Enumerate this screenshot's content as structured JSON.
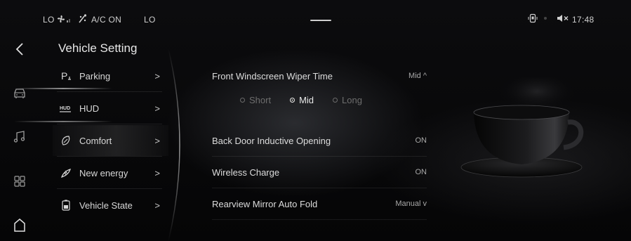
{
  "status_bar": {
    "left_temp": "LO",
    "ac_text": "A/C ON",
    "right_temp": "LO",
    "time": "17:48",
    "icons": [
      "fan-icon",
      "ac-icon",
      "phone-projection-icon",
      "mute-icon"
    ]
  },
  "nav": {
    "icons": [
      "back-icon",
      "car-icon",
      "music-icon",
      "apps-icon",
      "home-icon"
    ]
  },
  "page": {
    "title": "Vehicle Setting"
  },
  "menu": {
    "items": [
      {
        "label": "Parking",
        "arrow": ">",
        "icon": "parking-icon"
      },
      {
        "label": "HUD",
        "arrow": ">",
        "icon": "hud-icon"
      },
      {
        "label": "Comfort",
        "arrow": ">",
        "icon": "comfort-icon",
        "selected": true
      },
      {
        "label": "New energy",
        "arrow": ">",
        "icon": "new-energy-icon"
      },
      {
        "label": "Vehicle State",
        "arrow": ">",
        "icon": "vehicle-state-icon"
      }
    ]
  },
  "settings": {
    "wiper": {
      "label": "Front Windscreen Wiper Time",
      "value": "Mid ^",
      "options": [
        "Short",
        "Mid",
        "Long"
      ],
      "selected": "Mid"
    },
    "back_door": {
      "label": "Back Door Inductive Opening",
      "value": "ON"
    },
    "wireless": {
      "label": "Wireless Charge",
      "value": "ON"
    },
    "mirror": {
      "label": "Rearview Mirror Auto Fold",
      "value": "Manual v"
    }
  },
  "colors": {
    "text": "#d8d8d8",
    "muted": "#6e6e6e",
    "background": "#050506"
  }
}
